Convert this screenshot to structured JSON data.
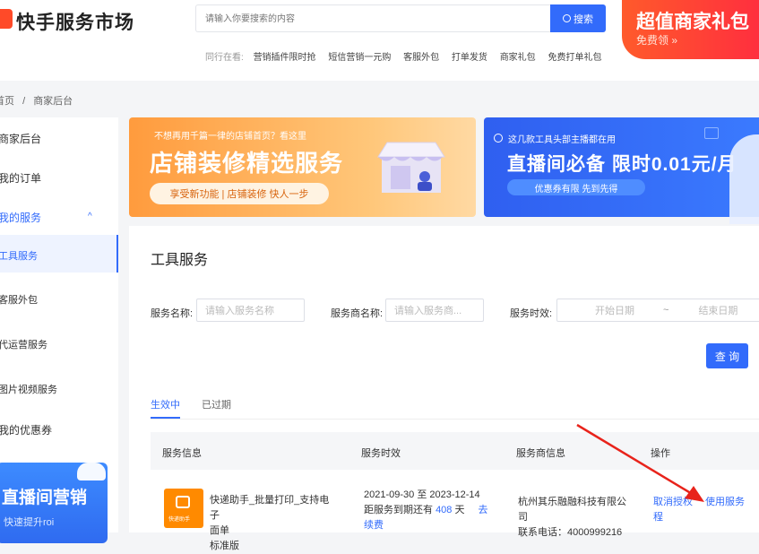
{
  "header": {
    "logo_text": "快手服务市场",
    "search_placeholder": "请输入你要搜索的内容",
    "search_button": "搜索",
    "hot_label": "同行在看:",
    "hot_links": [
      "营销插件限时抢",
      "短信营销一元购",
      "客服外包",
      "打单发货",
      "商家礼包",
      "免费打单礼包"
    ],
    "promo_title": "超值商家礼包",
    "promo_sub": "免费领 »"
  },
  "breadcrumb": {
    "home": "首页",
    "sep": "/",
    "current": "商家后台"
  },
  "sidebar": {
    "items": [
      {
        "label": "商家后台"
      },
      {
        "label": "我的订单"
      },
      {
        "label": "我的服务"
      },
      {
        "label": "工具服务"
      },
      {
        "label": "客服外包"
      },
      {
        "label": "代运营服务"
      },
      {
        "label": "图片视频服务"
      },
      {
        "label": "我的优惠券"
      }
    ],
    "banner_title": "直播间营销",
    "banner_sub": "快速提升roi"
  },
  "banners": {
    "left_small": "不想再用千篇一律的店铺首页？看这里",
    "left_title": "店铺装修精选服务",
    "left_pill": "享受新功能 | 店铺装修 快人一步",
    "right_small": "这几款工具头部主播都在用",
    "right_title": "直播间必备 限时0.01元/月",
    "right_pill": "优惠券有限 先到先得"
  },
  "main": {
    "title": "工具服务",
    "filters": {
      "name_label": "服务名称:",
      "name_placeholder": "请输入服务名称",
      "provider_label": "服务商名称:",
      "provider_placeholder": "请输入服务商...",
      "period_label": "服务时效:",
      "start_placeholder": "开始日期",
      "range_sep": "~",
      "end_placeholder": "结束日期"
    },
    "query_button": "查 询",
    "tabs": [
      {
        "label": "生效中",
        "active": true
      },
      {
        "label": "已过期",
        "active": false
      }
    ],
    "table": {
      "headers": [
        "服务信息",
        "服务时效",
        "服务商信息",
        "操作"
      ],
      "rows": [
        {
          "icon_text": "快递助手",
          "name_line1": "快递助手_批量打印_支持电子",
          "name_line2": "面单",
          "edition": "标准版",
          "date_range": "2021-09-30 至 2023-12-14",
          "remain_prefix": "距服务到期还有",
          "remain_days": "408",
          "remain_suffix": "天",
          "renew_1": "去",
          "renew_2": "续费",
          "provider_line1": "杭州其乐融融科技有限公",
          "provider_line2": "司",
          "phone": "联系电话：4000999216",
          "cancel_1": "取消授权",
          "cancel_2": "程",
          "use": "使用服务"
        }
      ]
    }
  },
  "colors": {
    "accent": "#326bfb",
    "brand": "#ff4a28",
    "annotation_arrow": "#e8231b"
  }
}
